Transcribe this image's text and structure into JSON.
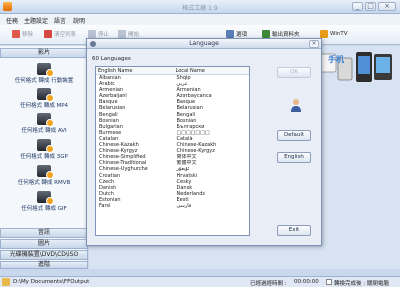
{
  "window": {
    "title": "格式工廠 1.9",
    "menu": [
      "任務",
      "主題設定",
      "語言",
      "說明"
    ]
  },
  "toolbar": {
    "items": [
      {
        "label": "移除",
        "icon": "remove-icon",
        "active": false
      },
      {
        "label": "清空列表",
        "icon": "clear-list-icon",
        "active": false
      },
      {
        "label": "停止",
        "icon": "stop-icon",
        "active": false
      },
      {
        "label": "開始",
        "icon": "start-icon",
        "active": false
      },
      {
        "label": "選項",
        "icon": "options-icon",
        "active": true
      },
      {
        "label": "輸出資料夾",
        "icon": "output-folder-icon",
        "active": true
      },
      {
        "label": "WinTV",
        "icon": "wintv-icon",
        "active": true
      }
    ]
  },
  "sidebar": {
    "header": "影片",
    "formats": [
      "任何格式 轉成 行動裝置",
      "任何格式 轉成 MP4",
      "任何格式 轉成 AVI",
      "任何格式 轉成 3GP",
      "任何格式 轉成 RMVB",
      "任何格式 轉成 GIF"
    ],
    "categories": [
      "音訊",
      "圖片",
      "光碟機裝置\\DVD\\CD\\ISO",
      "進階"
    ]
  },
  "banner": {
    "text": "手机"
  },
  "statusbar": {
    "path": "D:\\My Documents\\FFOutput",
    "elapsed_label": "已經過經時間 :",
    "elapsed_value": "00:00:00",
    "after_convert": "轉換完成後 : 關閉電腦"
  },
  "dialog": {
    "title": "Language",
    "count": "60 Languages",
    "col_english": "English Name",
    "col_local": "Local Name",
    "languages": [
      [
        "Albanian",
        "Shqip"
      ],
      [
        "Arabic",
        "عربي"
      ],
      [
        "Armenian",
        "Armenian"
      ],
      [
        "Azerbaijani",
        "Azərbaycanca"
      ],
      [
        "Basque",
        "Basque"
      ],
      [
        "Belarusian",
        "Belarusian"
      ],
      [
        "Bengali",
        "Bengali"
      ],
      [
        "Bosnian",
        "Bosnian"
      ],
      [
        "Bulgarian",
        "Български"
      ],
      [
        "Burmese",
        "□□□□□□□"
      ],
      [
        "Catalan",
        "Català"
      ],
      [
        "Chinese-Kazakh",
        "Chinese-Kazakh"
      ],
      [
        "Chinese-Kyrgyz",
        "Chinese-Kyrgyz"
      ],
      [
        "Chinese-Simplified",
        "简体中文"
      ],
      [
        "Chinese-Traditional",
        "繁體中文"
      ],
      [
        "Chinese-Uyghurche",
        "ئۇيغۇر"
      ],
      [
        "Croatian",
        "Hrvatski"
      ],
      [
        "Czech",
        "Česky"
      ],
      [
        "Danish",
        "Dansk"
      ],
      [
        "Dutch",
        "Nederlands"
      ],
      [
        "Estonian",
        "Eesti"
      ],
      [
        "Farsi",
        "فارسی"
      ]
    ],
    "buttons": {
      "ok": "OK",
      "default": "Default",
      "english": "English",
      "exit": "Exit"
    }
  }
}
